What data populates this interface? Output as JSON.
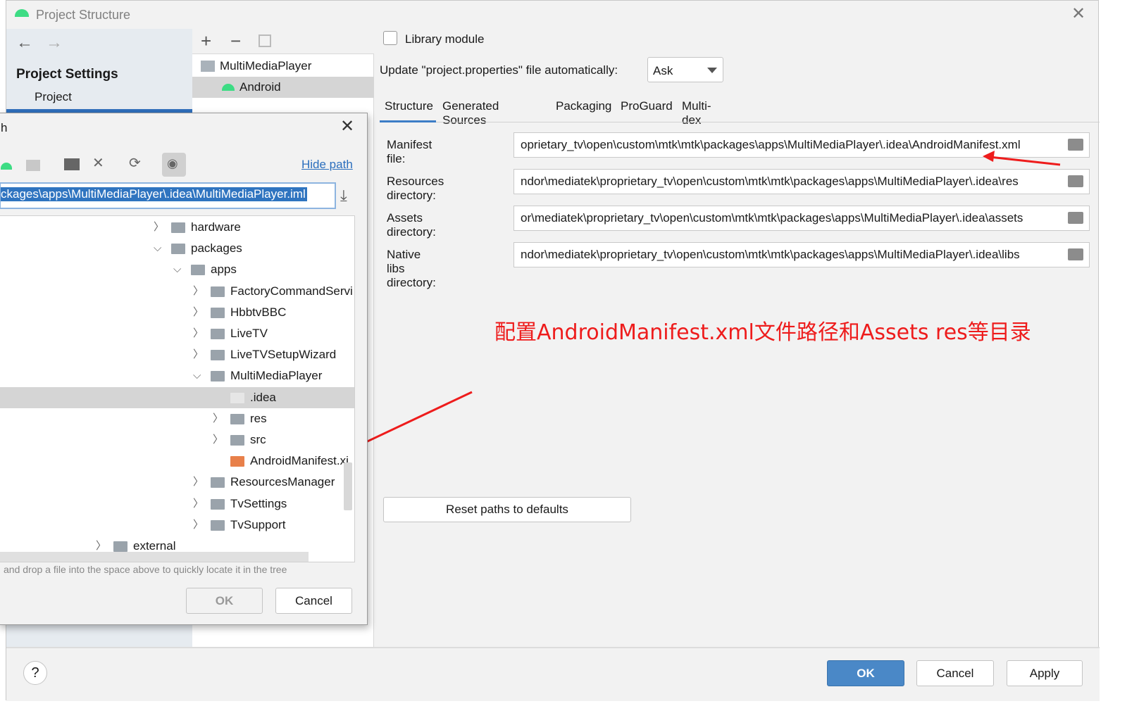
{
  "window": {
    "title": "Project Structure",
    "accent": "#3d7dc6"
  },
  "sidebar": {
    "section": "Project Settings",
    "items": [
      {
        "label": "Project"
      }
    ]
  },
  "modules": {
    "items": [
      {
        "label": "MultiMediaPlayer"
      },
      {
        "label": "Android",
        "selected": true
      }
    ]
  },
  "settings": {
    "library_module": "Library module",
    "library_checked": false,
    "update_label": "Update \"project.properties\" file automatically:",
    "update_value": "Ask",
    "tabs": [
      {
        "label": "Structure",
        "active": true
      },
      {
        "label": "Generated Sources"
      },
      {
        "label": "Packaging"
      },
      {
        "label": "ProGuard"
      },
      {
        "label": "Multi-dex"
      }
    ],
    "fields": [
      {
        "label": "Manifest file:",
        "value": "oprietary_tv\\open\\custom\\mtk\\mtk\\packages\\apps\\MultiMediaPlayer\\.idea\\AndroidManifest.xml"
      },
      {
        "label": "Resources directory:",
        "value": "ndor\\mediatek\\proprietary_tv\\open\\custom\\mtk\\mtk\\packages\\apps\\MultiMediaPlayer\\.idea\\res"
      },
      {
        "label": "Assets directory:",
        "value": "or\\mediatek\\proprietary_tv\\open\\custom\\mtk\\mtk\\packages\\apps\\MultiMediaPlayer\\.idea\\assets"
      },
      {
        "label": "Native libs directory:",
        "value": "ndor\\mediatek\\proprietary_tv\\open\\custom\\mtk\\mtk\\packages\\apps\\MultiMediaPlayer\\.idea\\libs"
      }
    ],
    "reset": "Reset paths to defaults"
  },
  "annotation": {
    "text": "配置AndroidManifest.xml文件路径和Assets res等目录",
    "color": "#ee1c1c"
  },
  "footer": {
    "help": "?",
    "ok": "OK",
    "cancel": "Cancel",
    "apply": "Apply"
  },
  "dialog": {
    "title": "h",
    "hide_path": "Hide path",
    "path": "ckages\\apps\\MultiMediaPlayer\\.idea\\MultiMediaPlayer.iml",
    "hint": "and drop a file into the space above to quickly locate it in the tree",
    "ok": "OK",
    "cancel": "Cancel",
    "tree": [
      {
        "label": "hardware",
        "level": 1,
        "exp": false
      },
      {
        "label": "packages",
        "level": 1,
        "exp": true
      },
      {
        "label": "apps",
        "level": 2,
        "exp": true
      },
      {
        "label": "FactoryCommandServi",
        "level": 3,
        "exp": false
      },
      {
        "label": "HbbtvBBC",
        "level": 3,
        "exp": false
      },
      {
        "label": "LiveTV",
        "level": 3,
        "exp": false
      },
      {
        "label": "LiveTVSetupWizard",
        "level": 3,
        "exp": false
      },
      {
        "label": "MultiMediaPlayer",
        "level": 3,
        "exp": true
      },
      {
        "label": ".idea",
        "level": 4,
        "exp": null,
        "selected": true
      },
      {
        "label": "res",
        "level": 4,
        "exp": false
      },
      {
        "label": "src",
        "level": 4,
        "exp": false
      },
      {
        "label": "AndroidManifest.xi",
        "level": 4,
        "exp": null,
        "file": true
      },
      {
        "label": "ResourcesManager",
        "level": 3,
        "exp": false
      },
      {
        "label": "TvSettings",
        "level": 3,
        "exp": false
      },
      {
        "label": "TvSupport",
        "level": 3,
        "exp": false
      },
      {
        "label": "external",
        "level": 0,
        "exp": false
      }
    ]
  }
}
